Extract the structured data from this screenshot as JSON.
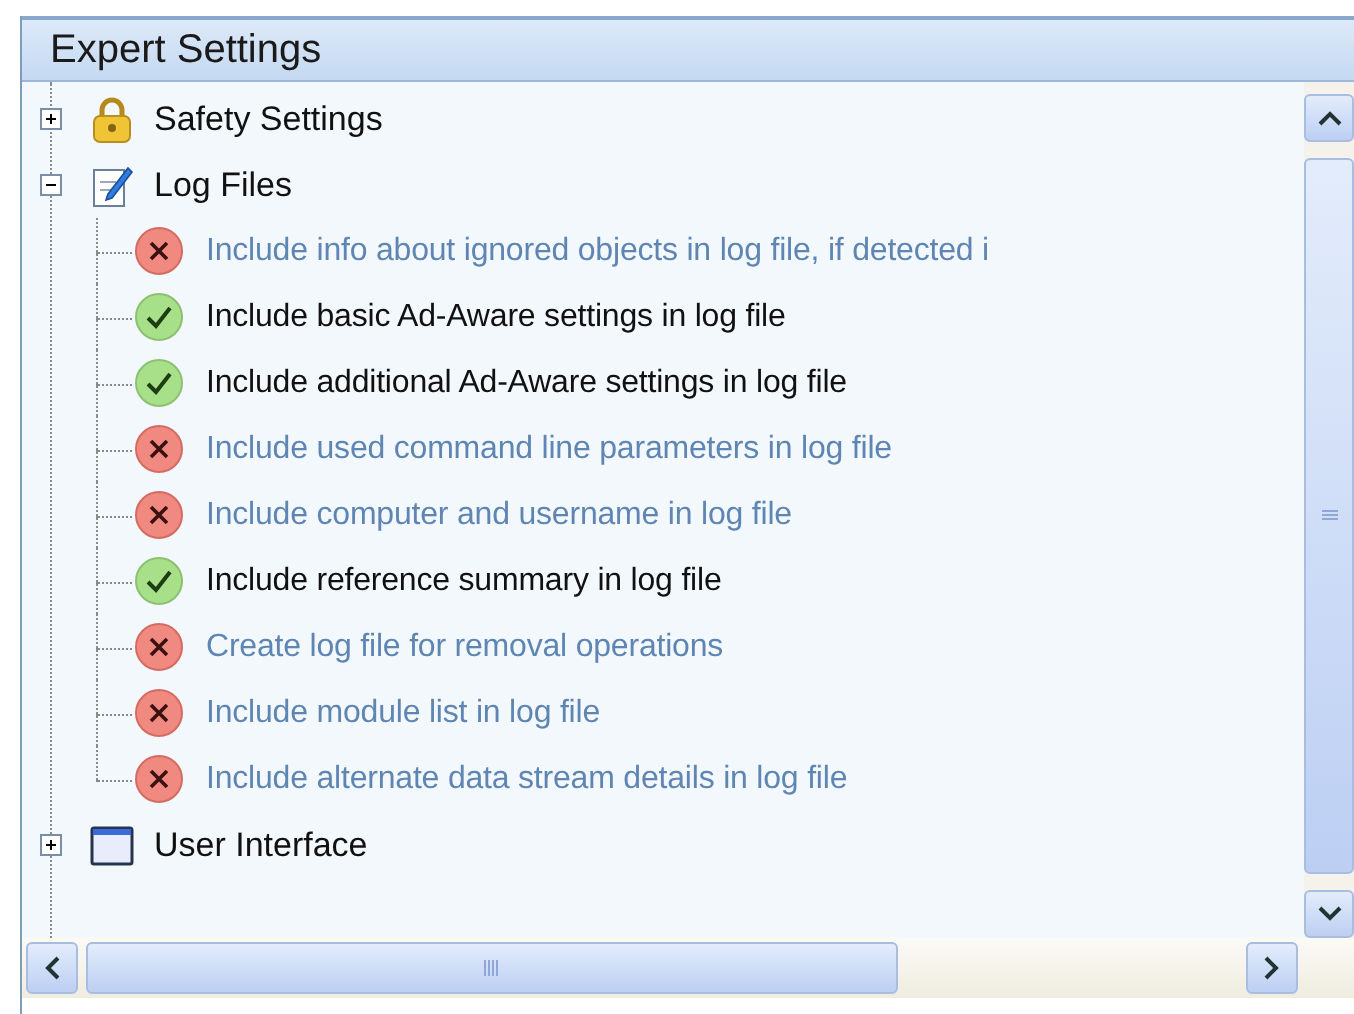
{
  "panel": {
    "title": "Expert Settings"
  },
  "tree": [
    {
      "label": "Safety Settings",
      "kind": "lock",
      "expanded": false
    },
    {
      "label": "Log Files",
      "kind": "notepad",
      "expanded": true,
      "children": [
        {
          "label": "Include info about ignored objects in log file, if detected i",
          "enabled": false
        },
        {
          "label": "Include basic Ad-Aware settings in log file",
          "enabled": true
        },
        {
          "label": "Include additional Ad-Aware settings in log file",
          "enabled": true
        },
        {
          "label": "Include used command line parameters in log file",
          "enabled": false
        },
        {
          "label": "Include computer and username in log file",
          "enabled": false
        },
        {
          "label": "Include reference summary in log file",
          "enabled": true
        },
        {
          "label": "Create log file for removal operations",
          "enabled": false
        },
        {
          "label": "Include module list in log file",
          "enabled": false
        },
        {
          "label": "Include alternate data stream details in log file",
          "enabled": false
        }
      ]
    },
    {
      "label": "User Interface",
      "kind": "window",
      "expanded": false
    }
  ]
}
